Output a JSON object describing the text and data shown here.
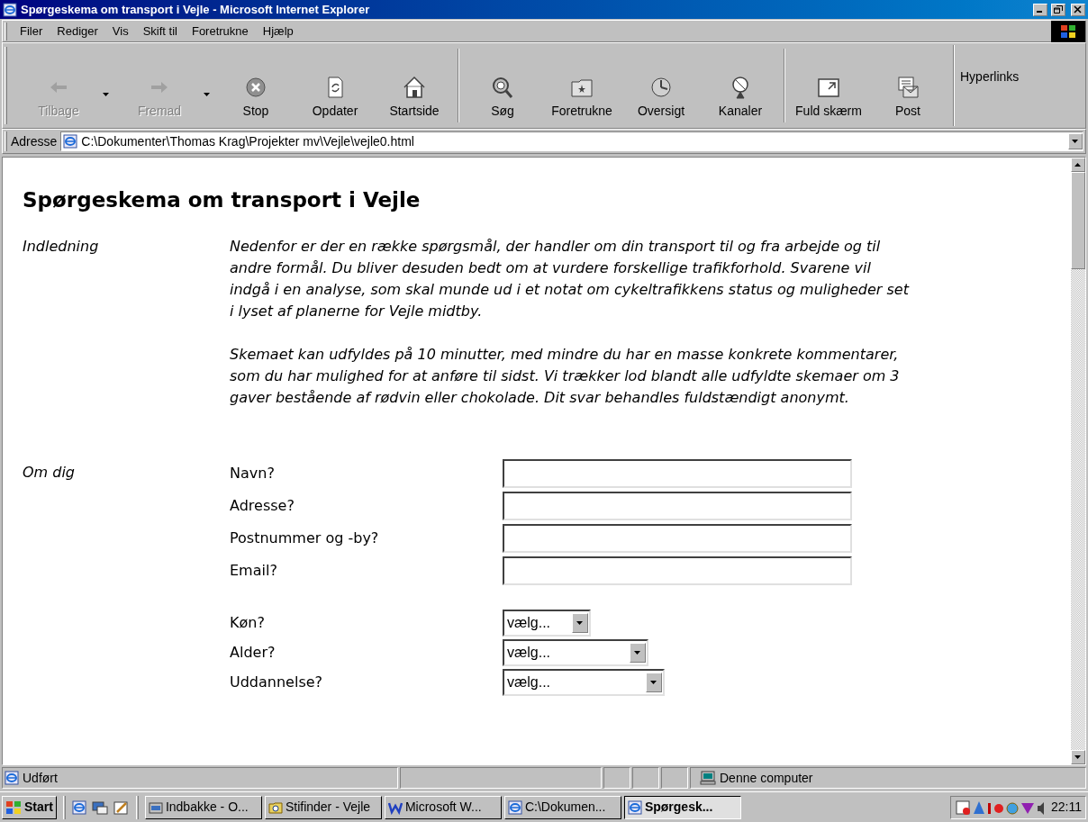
{
  "window": {
    "title": "Spørgeskema om transport i Vejle - Microsoft Internet Explorer"
  },
  "menu": [
    "Filer",
    "Rediger",
    "Vis",
    "Skift til",
    "Foretrukne",
    "Hjælp"
  ],
  "toolbar": {
    "groups": [
      [
        {
          "label": "Tilbage",
          "disabled": true,
          "dropdown": true
        },
        {
          "label": "Fremad",
          "disabled": true,
          "dropdown": true
        },
        {
          "label": "Stop",
          "disabled": false,
          "dropdown": false
        },
        {
          "label": "Opdater",
          "disabled": false,
          "dropdown": false
        },
        {
          "label": "Startside",
          "disabled": false,
          "dropdown": false
        }
      ],
      [
        {
          "label": "Søg",
          "disabled": false,
          "dropdown": false
        },
        {
          "label": "Foretrukne",
          "disabled": false,
          "dropdown": false
        },
        {
          "label": "Oversigt",
          "disabled": false,
          "dropdown": false
        },
        {
          "label": "Kanaler",
          "disabled": false,
          "dropdown": false
        }
      ],
      [
        {
          "label": "Fuld skærm",
          "disabled": false,
          "dropdown": false
        },
        {
          "label": "Post",
          "disabled": false,
          "dropdown": false
        }
      ]
    ],
    "links": "Hyperlinks"
  },
  "address": {
    "label": "Adresse",
    "value": "C:\\Dokumenter\\Thomas Krag\\Projekter mv\\Vejle\\vejle0.html"
  },
  "page": {
    "heading": "Spørgeskema om transport i Vejle",
    "intro": {
      "label": "Indledning",
      "paragraphs": [
        "Nedenfor er der en række spørgsmål, der handler om din transport til og fra arbejde og til andre formål. Du bliver desuden bedt om at vurdere forskellige trafikforhold. Svarene vil indgå i en analyse, som skal munde ud i et notat om cykeltrafikkens status og muligheder set i lyset af planerne for Vejle midtby.",
        "Skemaet kan udfyldes på 10 minutter, med mindre du har en masse konkrete kommentarer, som du har mulighed for at anføre til sidst. Vi trækker lod blandt alle udfyldte skemaer om 3 gaver bestående af rødvin eller chokolade. Dit svar behandles fuldstændigt anonymt."
      ]
    },
    "about": {
      "label": "Om dig",
      "text_fields": [
        {
          "label": "Navn?"
        },
        {
          "label": "Adresse?"
        },
        {
          "label": "Postnummer og -by?"
        },
        {
          "label": "Email?"
        }
      ],
      "selects": [
        {
          "label": "Køn?",
          "value": "vælg..."
        },
        {
          "label": "Alder?",
          "value": "vælg..."
        },
        {
          "label": "Uddannelse?",
          "value": "vælg..."
        }
      ]
    }
  },
  "status_bar": {
    "text": "Udført",
    "zone": "Denne computer"
  },
  "taskbar": {
    "start": "Start",
    "tasks": [
      {
        "label": "Indbakke - O...",
        "selected": false
      },
      {
        "label": "Stifinder - Vejle",
        "selected": false
      },
      {
        "label": "Microsoft W...",
        "selected": false
      },
      {
        "label": "C:\\Dokumen...",
        "selected": false
      },
      {
        "label": "Spørgesk...",
        "selected": true
      }
    ],
    "clock": "22:11"
  }
}
